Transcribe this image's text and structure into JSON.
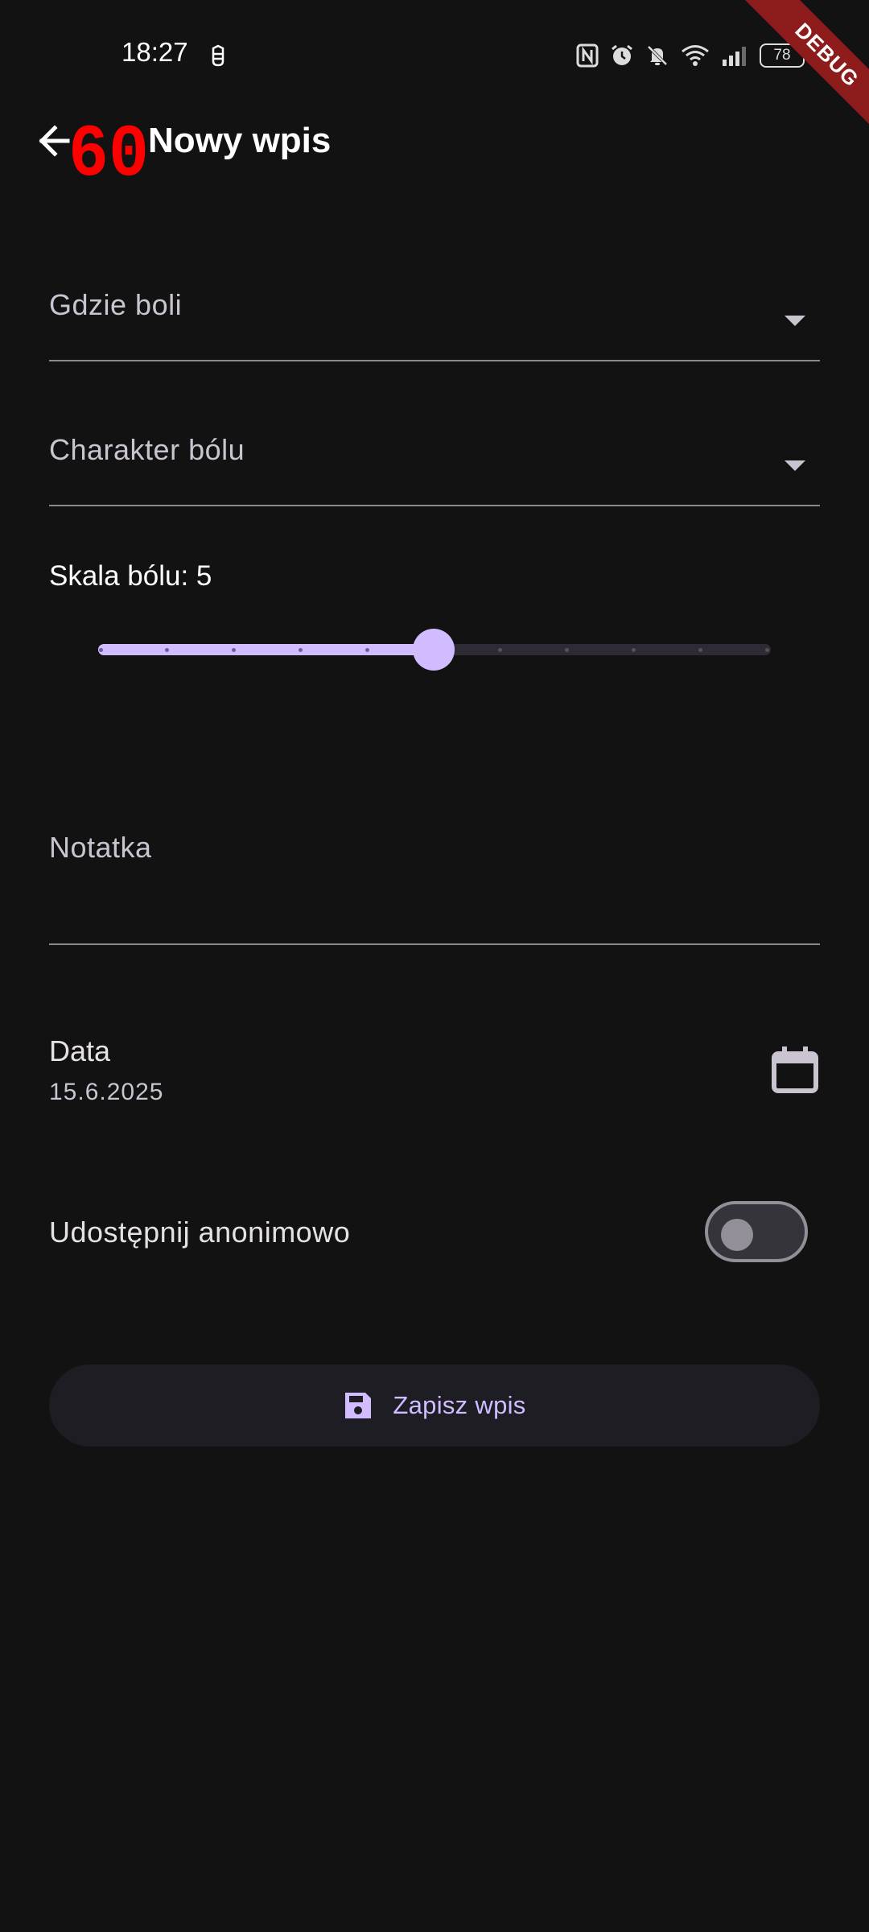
{
  "status_bar": {
    "time": "18:27",
    "battery_level": "78",
    "icons": [
      "debug-bug-icon",
      "nfc-icon",
      "alarm-icon",
      "bell-off-icon",
      "wifi-icon",
      "signal-icon",
      "battery-icon"
    ]
  },
  "debug_banner": "DEBUG",
  "app_bar": {
    "back_icon": "arrow-left-icon",
    "fps_overlay": "60",
    "title": "Nowy wpis"
  },
  "form": {
    "location_label": "Gdzie boli",
    "pain_type_label": "Charakter bólu",
    "pain_scale": {
      "label": "Skala bólu: 5",
      "value": 5,
      "min": 0,
      "max": 10,
      "divisions": 10
    },
    "note_label": "Notatka",
    "date_label": "Data",
    "date_value": "15.6.2025",
    "share_label": "Udostępnij anonimowo",
    "share_enabled": false,
    "save_label": "Zapisz wpis"
  },
  "colors": {
    "background": "#121212",
    "accent": "#d0bcff",
    "debug_banner": "#8e1c1c",
    "fps_overlay": "#ff0000"
  }
}
